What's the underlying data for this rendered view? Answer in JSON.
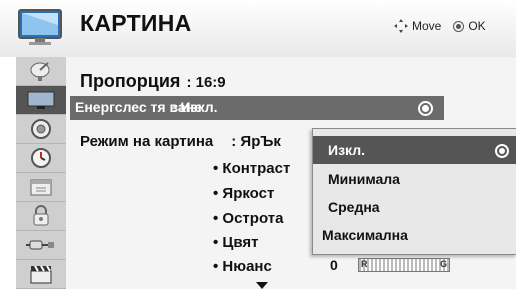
{
  "header": {
    "title": "КАРТИНА",
    "move_label": "Move",
    "ok_label": "OK"
  },
  "sidebar": {
    "items": [
      {
        "icon": "satellite-dish-icon"
      },
      {
        "icon": "picture-monitor-icon",
        "active": true
      },
      {
        "icon": "speaker-icon"
      },
      {
        "icon": "clock-icon"
      },
      {
        "icon": "calendar-icon"
      },
      {
        "icon": "lock-icon"
      },
      {
        "icon": "input-plug-icon"
      },
      {
        "icon": "clapperboard-icon"
      }
    ]
  },
  "menu": {
    "ratio_label": "Пропорция",
    "ratio_value": ": 16:9",
    "energy_label": "Енергслес тя ване",
    "energy_value": ": Изкл.",
    "mode_label": "Режим на картина",
    "mode_value": ": ЯрЪк",
    "sub_items": [
      "Контраст",
      "Яркост",
      "Острота",
      "Цвят",
      "Нюанс"
    ],
    "tint_value": "0",
    "tint_left": "R",
    "tint_right": "G"
  },
  "dropdown": {
    "options": [
      "Изкл.",
      "Минимала",
      "Средна",
      "Максимална"
    ],
    "selected_index": 0
  }
}
